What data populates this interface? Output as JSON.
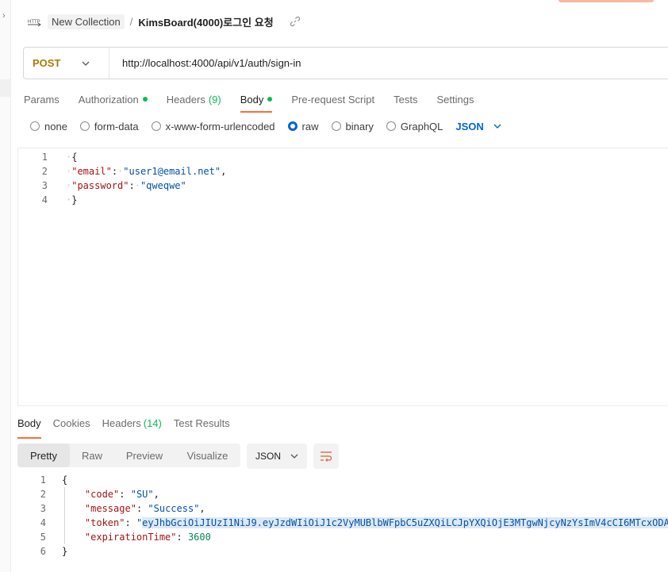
{
  "header": {
    "collection": "New Collection",
    "separator": "/",
    "request_title": "KimsBoard(4000)로그인 요청"
  },
  "request": {
    "method": "POST",
    "url": "http://localhost:4000/api/v1/auth/sign-in"
  },
  "request_tabs": [
    {
      "label": "Params"
    },
    {
      "label": "Authorization",
      "dot": true
    },
    {
      "label": "Headers",
      "count": "(9)"
    },
    {
      "label": "Body",
      "dot": true,
      "active": true
    },
    {
      "label": "Pre-request Script"
    },
    {
      "label": "Tests"
    },
    {
      "label": "Settings"
    }
  ],
  "body_types": [
    {
      "label": "none"
    },
    {
      "label": "form-data"
    },
    {
      "label": "x-www-form-urlencoded"
    },
    {
      "label": "raw",
      "selected": true
    },
    {
      "label": "binary"
    },
    {
      "label": "GraphQL"
    }
  ],
  "body_format": "JSON",
  "request_body": {
    "line_numbers": [
      "1",
      "2",
      "3",
      "4"
    ],
    "open": "{",
    "close": "}",
    "email_key": "\"email\"",
    "email_value": "\"user1@email.net\"",
    "password_key": "\"password\"",
    "password_value": "\"qweqwe\""
  },
  "response_tabs": [
    {
      "label": "Body",
      "active": true
    },
    {
      "label": "Cookies"
    },
    {
      "label": "Headers",
      "count": "(14)"
    },
    {
      "label": "Test Results"
    }
  ],
  "response_views": [
    "Pretty",
    "Raw",
    "Preview",
    "Visualize"
  ],
  "response_format": "JSON",
  "response_body": {
    "line_numbers": [
      "1",
      "2",
      "3",
      "4",
      "5",
      "6"
    ],
    "open": "{",
    "close": "}",
    "code_key": "\"code\"",
    "code_value": "\"SU\"",
    "message_key": "\"message\"",
    "message_value": "\"Success\"",
    "token_key": "\"token\"",
    "token_value": "eyJhbGciOiJIUzI1NiJ9.eyJzdWIiOiJ1c2VyMUBlbWFpbC5uZXQiLCJpYXQiOjE3MTgwNjcyNzYsImV4cCI6MTcxODA",
    "expiration_key": "\"expirationTime\"",
    "expiration_value": "3600"
  },
  "colors": {
    "accent": "#ff6c37",
    "method": "#ad7a03",
    "link": "#0265d2",
    "success_dot": "#0cbb52"
  }
}
